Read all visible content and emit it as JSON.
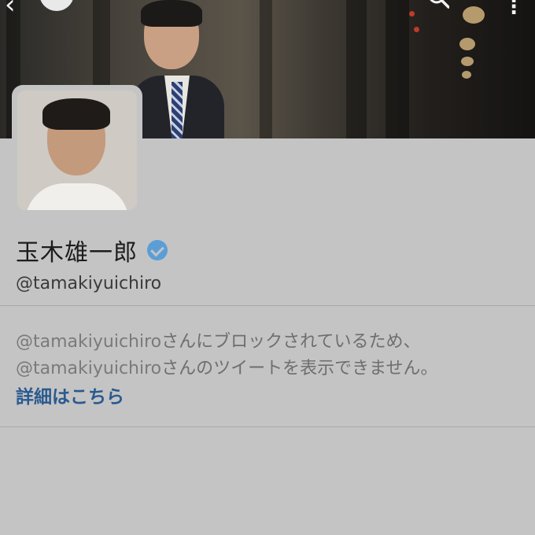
{
  "header": {
    "back_icon": "chevron-left-icon",
    "search_icon": "search-icon",
    "more_icon": "more-vertical-icon"
  },
  "profile": {
    "name": "玉木雄一郎",
    "verified_icon": "verified-badge-icon",
    "handle": "@tamakiyuichiro"
  },
  "message": {
    "line1_handle": "@tamakiyuichiro",
    "line1_text": "さんにブロックされているため、",
    "line2_handle": "@tamakiyuichiro",
    "line2_text": "さんのツイートを表示できません。",
    "learn_more": "詳細はこちら"
  },
  "colors": {
    "link": "#2a5a8f",
    "verified": "#5b9ed6",
    "background": "#c4c4c4"
  }
}
